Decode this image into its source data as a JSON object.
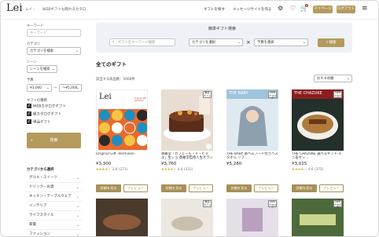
{
  "header": {
    "logo": "Lei",
    "logo_sub": "- レイ -",
    "tagline": "WEBギフトも贈れるカタロ",
    "nav": [
      "ギフトを探す",
      "メッセージサイトを作る"
    ],
    "cart_count": "0",
    "mypage": "マイページ",
    "login": "ログアウト"
  },
  "sidebar": {
    "keyword_label": "キーワード",
    "keyword_placeholder": "キーワード",
    "category_label": "カテゴリ",
    "category_value": "カテゴリを検索",
    "scene_label": "シーン",
    "scene_value": "シーンを検索",
    "price_label": "予算",
    "price_min": "¥3,000",
    "price_sep": "～",
    "price_max": "～¥5,000",
    "catalog_label": "ギフトの種類",
    "checks": [
      "WEBカタログギフト",
      "紙カタログギフト",
      "単品ギフト"
    ],
    "search_button": "検索",
    "cat_heading": "カテゴリから選択",
    "categories": [
      "グルメ・スイーツ",
      "ドリンク・お酒",
      "キッチン・テーブルウェア",
      "インテリア",
      "ライフスタイル",
      "家電",
      "ファッション"
    ]
  },
  "search": {
    "title": "簡単ギフト検索",
    "placeholder": "ギフトをキーワード検索",
    "category": "カテゴリを選択",
    "budget": "予算を選択",
    "button": "検索"
  },
  "main": {
    "title": "全てのギフト",
    "count": "該当する商品数：5000件",
    "sort": "おすすめ順"
  },
  "products": [
    {
      "title": "Original Gift -Vermilion-",
      "price": "¥3,300",
      "stars": "★★★★☆",
      "rating": "3.8 (271)",
      "thumb": "lei"
    },
    {
      "title": "香雅堂「カフェール・ド・ビミエ」生ショ 香雅堂監修人生オランジェ...",
      "price": "¥3,760",
      "stars": "★★★★☆",
      "rating": "4.8 (332)",
      "thumb": "cake"
    },
    {
      "title": "THE BABY 選べるフード付きバスタオル ソフ...",
      "price": "¥5,280",
      "stars": "",
      "rating": "",
      "thumb": "baby"
    },
    {
      "title": "THE CHAZUKE 選べるギフト-ミニ缶セッ...",
      "price": "¥3,025",
      "stars": "★★★★☆",
      "rating": "4.6 (375)",
      "thumb": "chazuke"
    }
  ],
  "card_buttons": {
    "detail": "詳細を見る",
    "preview": "プレビュー"
  },
  "thumb_text": {
    "lei": "Lei",
    "lei_sub": "Original Gift Vermilion",
    "baby": "THE BABY",
    "chazuke": "THE CHAZUKE",
    "web_tag": "WEB カタログ",
    "single_tag": "単品 ギフト"
  },
  "colors": {
    "accent": "#b59a5e",
    "search_bg": "#eef2f6",
    "star": "#d4a017"
  }
}
